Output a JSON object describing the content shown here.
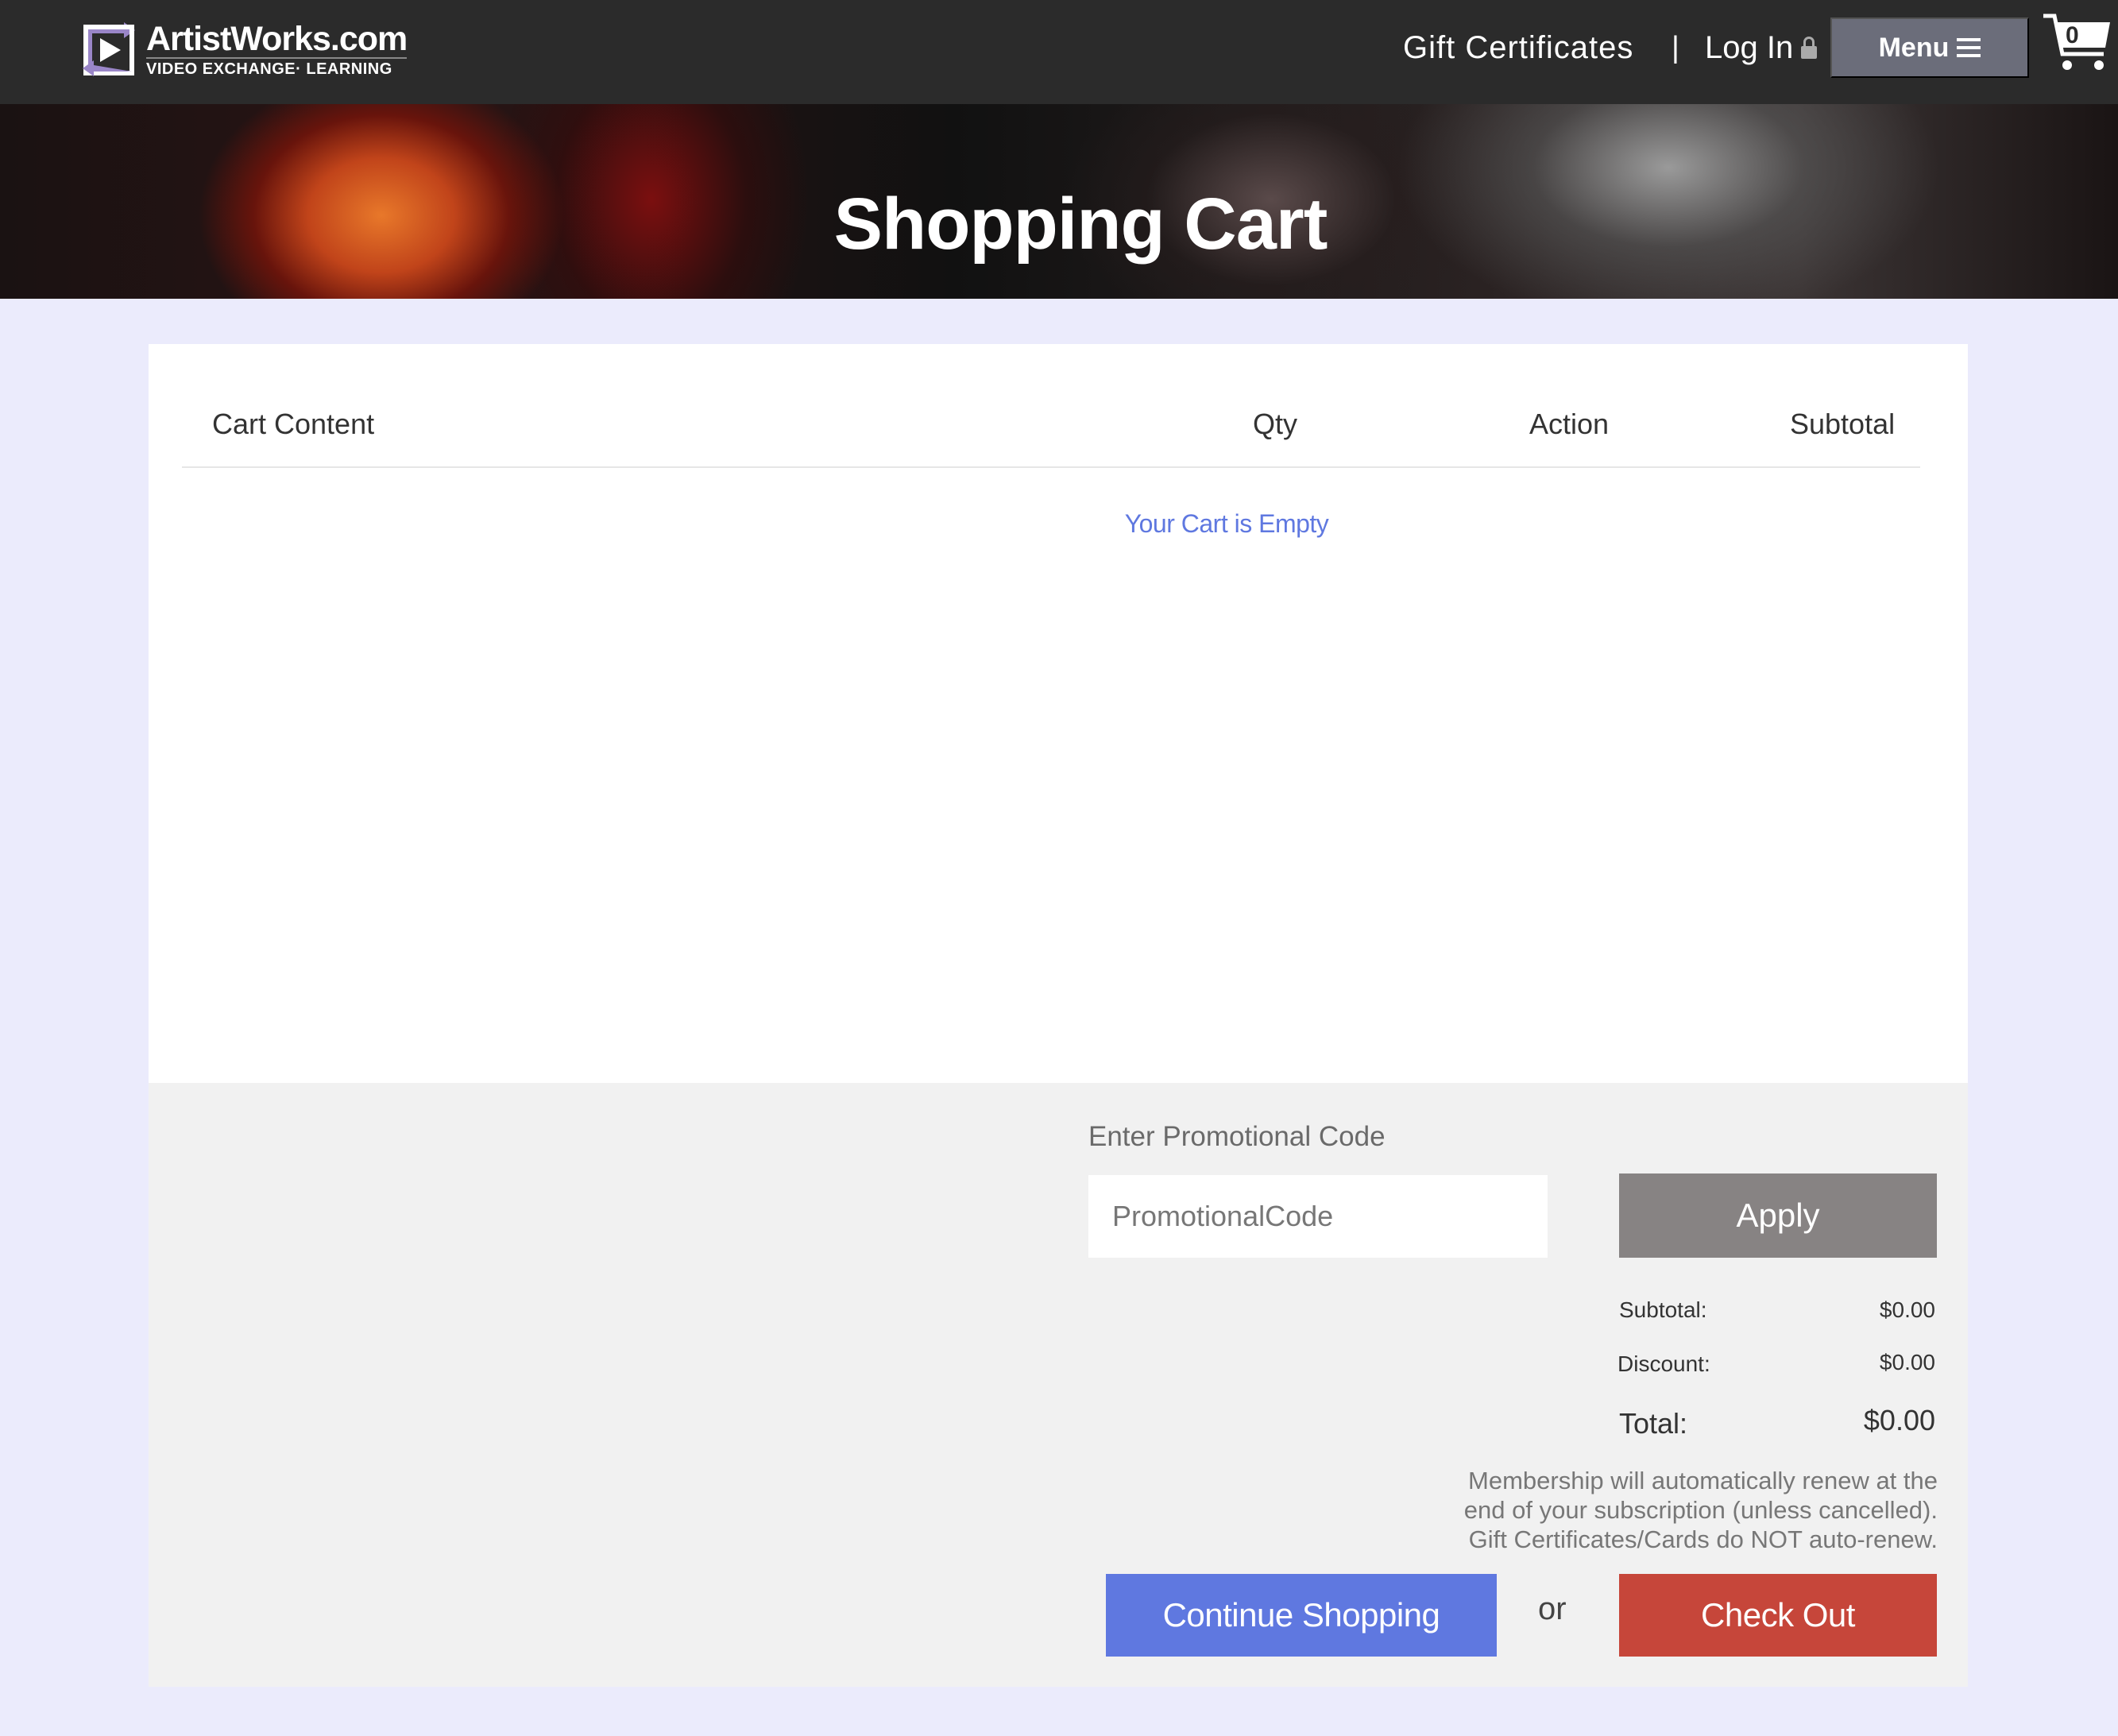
{
  "header": {
    "logo_name": "ArtistWorks.com",
    "logo_tagline": "VIDEO EXCHANGE· LEARNING",
    "gift_certificates": "Gift Certificates",
    "separator": "|",
    "login": "Log In",
    "menu": "Menu",
    "cart_count": "0"
  },
  "hero": {
    "title": "Shopping Cart"
  },
  "cart": {
    "columns": [
      "Cart Content",
      "Qty",
      "Action",
      "Subtotal"
    ],
    "empty_message": "Your Cart is Empty"
  },
  "summary": {
    "promo_label": "Enter Promotional Code",
    "promo_placeholder": "PromotionalCode",
    "apply": "Apply",
    "subtotal_label": "Subtotal:",
    "subtotal_value": "$0.00",
    "discount_label": "Discount:",
    "discount_value": "$0.00",
    "total_label": "Total:",
    "total_value": "$0.00",
    "renew_note_line1": "Membership will automatically renew at the",
    "renew_note_line2": "end of your subscription (unless cancelled).",
    "renew_note_line3": "Gift Certificates/Cards do NOT auto-renew.",
    "continue_shopping": "Continue Shopping",
    "or": "or",
    "checkout": "Check Out"
  },
  "colors": {
    "nav_bg": "#2b2b2b",
    "page_bg": "#ebebfc",
    "accent_blue": "#5f78e0",
    "checkout_red": "#c6463a",
    "apply_gray": "#878383",
    "menu_gray": "#6b6d7a"
  },
  "icons": [
    "play-logo-icon",
    "lock-icon",
    "hamburger-icon",
    "shopping-cart-icon"
  ]
}
